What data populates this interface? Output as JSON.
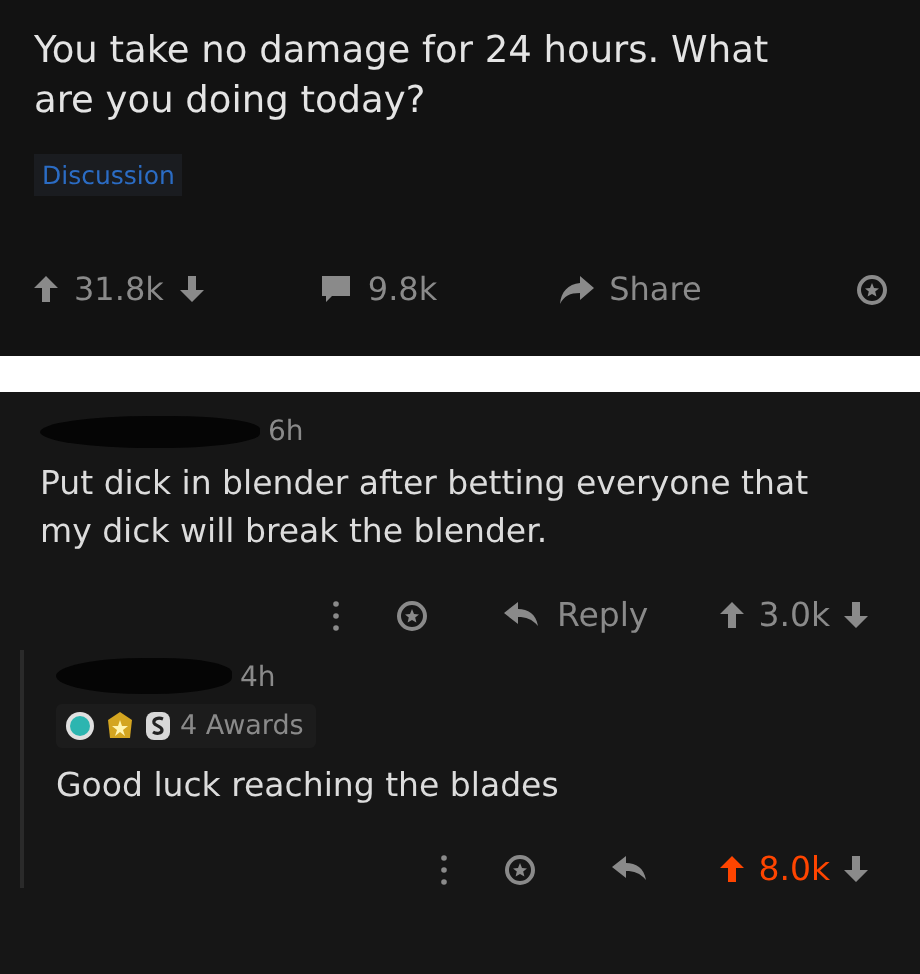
{
  "post": {
    "title": "You take no damage for 24 hours. What are you doing today?",
    "flair": "Discussion",
    "score": "31.8k",
    "upvoted": false,
    "comments": "9.8k",
    "share": "Share"
  },
  "comments": [
    {
      "time": "6h",
      "body": "Put dick in blender after betting everyone that my dick will break the blender.",
      "reply_label": "Reply",
      "score": "3.0k",
      "upvoted": false,
      "children": [
        {
          "time": "4h",
          "body": "Good luck reaching the blades",
          "score": "8.0k",
          "upvoted": true,
          "awards": "4 Awards"
        }
      ]
    }
  ]
}
